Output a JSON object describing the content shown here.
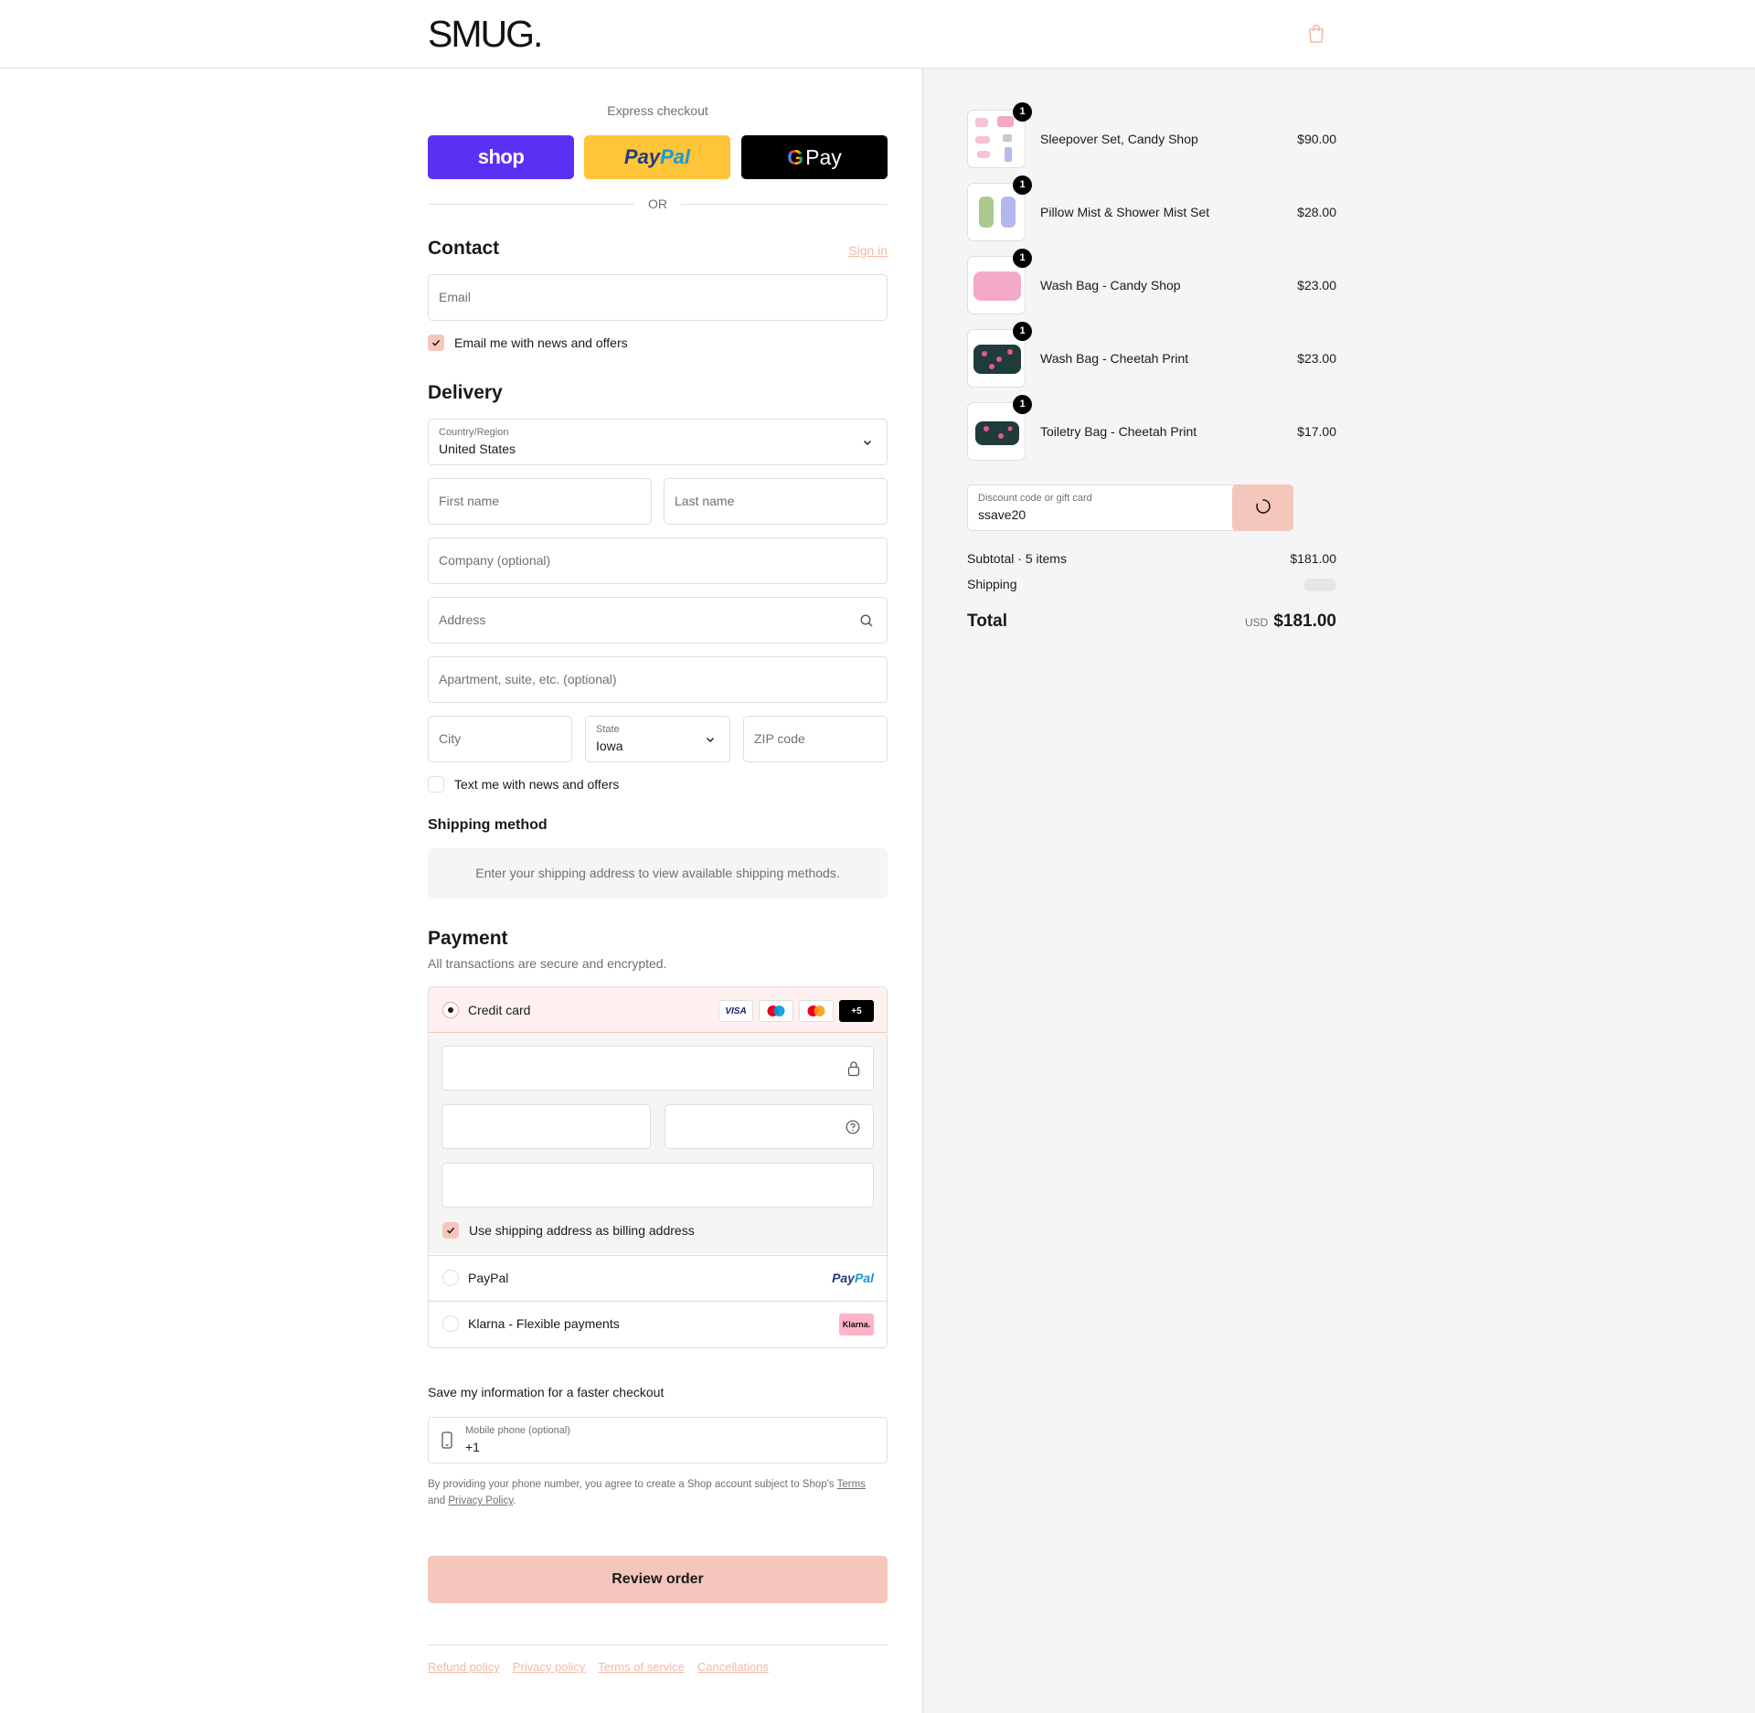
{
  "header": {
    "logo": "SMUG",
    "logo_dot": "."
  },
  "express": {
    "title": "Express checkout",
    "shop_label": "shop",
    "paypal_a": "Pay",
    "paypal_b": "Pal",
    "gpay_g": "G",
    "gpay_label": "Pay",
    "or": "OR"
  },
  "contact": {
    "title": "Contact",
    "signin": "Sign in",
    "email_placeholder": "Email",
    "news_checkbox": "Email me with news and offers",
    "news_checked": true
  },
  "delivery": {
    "title": "Delivery",
    "country_label": "Country/Region",
    "country_value": "United States",
    "first_name": "First name",
    "last_name": "Last name",
    "company": "Company (optional)",
    "address": "Address",
    "apartment": "Apartment, suite, etc. (optional)",
    "city": "City",
    "state_label": "State",
    "state_value": "Iowa",
    "zip": "ZIP code",
    "text_checkbox": "Text me with news and offers",
    "text_checked": false
  },
  "shipping": {
    "title": "Shipping method",
    "note": "Enter your shipping address to view available shipping methods."
  },
  "payment": {
    "title": "Payment",
    "subtitle": "All transactions are secure and encrypted.",
    "credit_card": "Credit card",
    "card_icons": [
      "VISA",
      "maestro",
      "mastercard",
      "+5"
    ],
    "billing_checkbox": "Use shipping address as billing address",
    "billing_checked": true,
    "paypal": "PayPal",
    "paypal_logo_a": "Pay",
    "paypal_logo_b": "Pal",
    "klarna": "Klarna - Flexible payments",
    "klarna_logo": "Klarna."
  },
  "save": {
    "title": "Save my information for a faster checkout",
    "phone_label": "Mobile phone (optional)",
    "phone_value": "+1",
    "legal_a": "By providing your phone number, you agree to create a Shop account subject to Shop's ",
    "legal_terms": "Terms",
    "legal_and": "and ",
    "legal_privacy": "Privacy Policy",
    "legal_end": "."
  },
  "review_button": "Review order",
  "footer": {
    "links": [
      "Refund policy",
      "Privacy policy",
      "Terms of service",
      "Cancellations"
    ]
  },
  "summary": {
    "items": [
      {
        "name": "Sleepover Set, Candy Shop",
        "price": "$90.00",
        "qty": "1"
      },
      {
        "name": "Pillow Mist & Shower Mist Set",
        "price": "$28.00",
        "qty": "1"
      },
      {
        "name": "Wash Bag - Candy Shop",
        "price": "$23.00",
        "qty": "1"
      },
      {
        "name": "Wash Bag - Cheetah Print",
        "price": "$23.00",
        "qty": "1"
      },
      {
        "name": "Toiletry Bag - Cheetah Print",
        "price": "$17.00",
        "qty": "1"
      }
    ],
    "discount_label": "Discount code or gift card",
    "discount_value": "ssave20",
    "subtotal_label": "Subtotal · 5 items",
    "subtotal_value": "$181.00",
    "shipping_label": "Shipping",
    "total_label": "Total",
    "currency": "USD",
    "total_value": "$181.00",
    "colors": {
      "accent": "#f5c6bc",
      "accent_text": "#f2b8a8",
      "shop_pay": "#5a31f4",
      "paypal": "#ffc439",
      "panel_bg": "#f5f5f5"
    }
  }
}
